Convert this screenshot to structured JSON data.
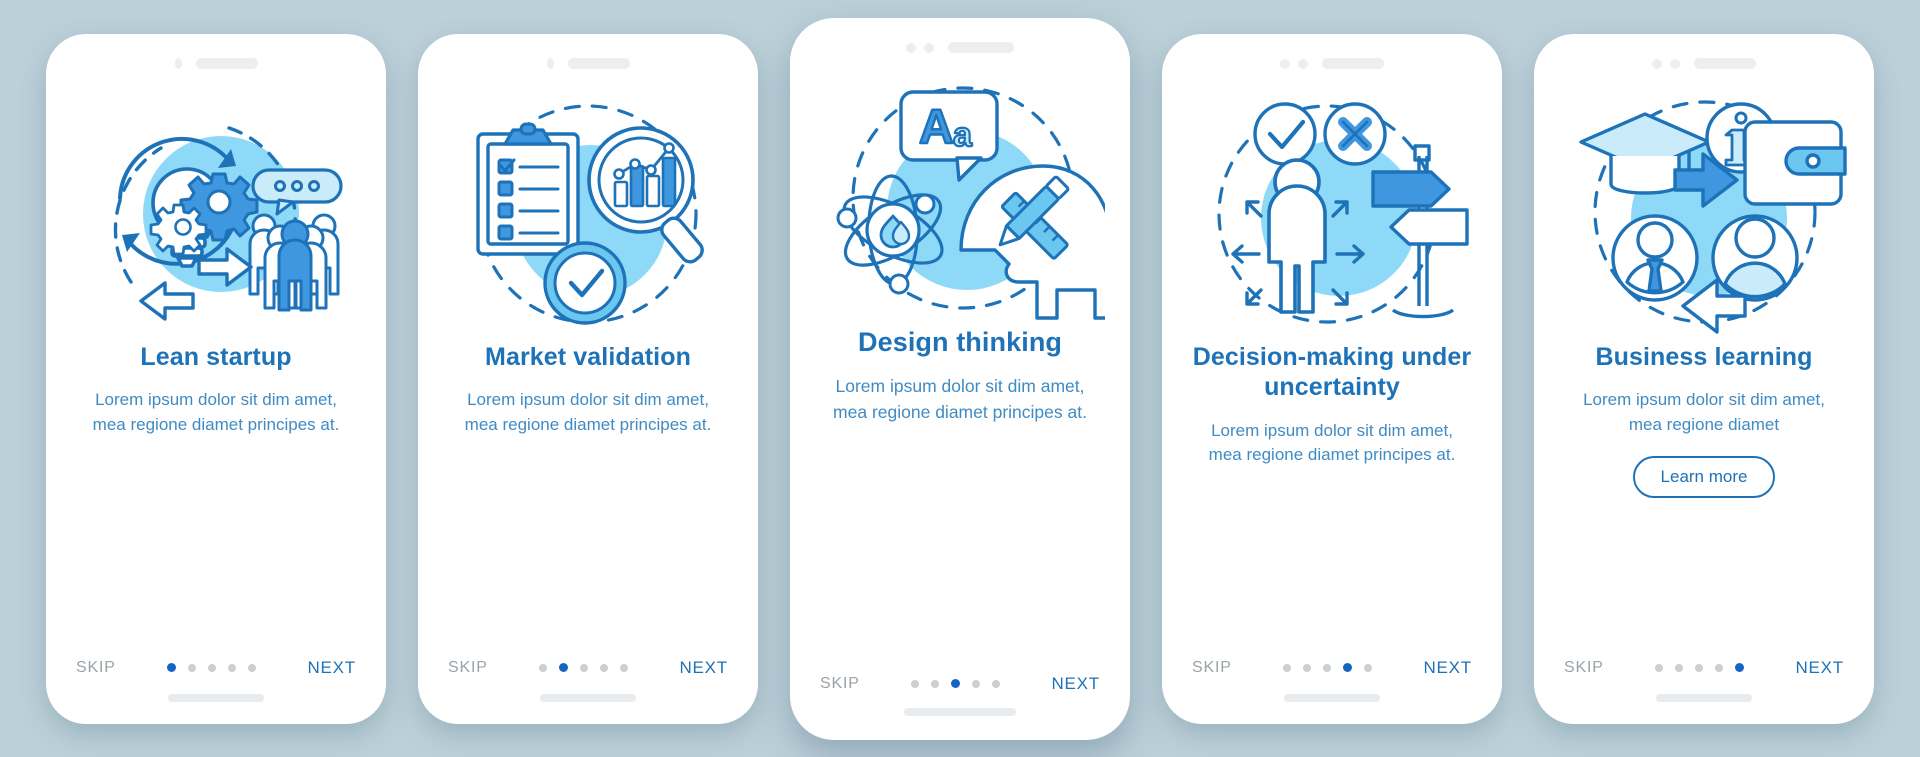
{
  "canvas": {
    "background_color": "#bcd0d9",
    "accent_color": "#1d72b8",
    "accent_dark": "#1565c0",
    "light_blue_fill": "#8ed8f8",
    "pale_blue_fill": "#c9ebfa",
    "muted_text_color": "#9aa3a8",
    "body_text_color": "#3f8bc4"
  },
  "common": {
    "skip_label": "SKIP",
    "next_label": "NEXT",
    "body_text": "Lorem ipsum dolor sit dim amet, mea regione diamet principes at.",
    "body_text_short": "Lorem ipsum dolor sit dim amet, mea regione diamet",
    "dot_count": 5
  },
  "screens": [
    {
      "id": "lean-startup",
      "title": "Lean startup",
      "body": "Lorem ipsum dolor sit dim amet, mea regione diamet principes at.",
      "skip_label": "SKIP",
      "next_label": "NEXT",
      "active_dot": 1,
      "icon_name": "lightbulb-gears-team-icon",
      "featured": false,
      "camera_dots": 1,
      "cta": null
    },
    {
      "id": "market-validation",
      "title": "Market validation",
      "body": "Lorem ipsum dolor sit dim amet, mea regione diamet principes at.",
      "skip_label": "SKIP",
      "next_label": "NEXT",
      "active_dot": 2,
      "icon_name": "clipboard-checklist-magnifier-icon",
      "featured": false,
      "camera_dots": 1,
      "cta": null
    },
    {
      "id": "design-thinking",
      "title": "Design thinking",
      "body": "Lorem ipsum dolor sit dim amet, mea regione diamet principes at.",
      "skip_label": "SKIP",
      "next_label": "NEXT",
      "active_dot": 3,
      "icon_name": "head-atom-ruler-pencil-icon",
      "featured": true,
      "camera_dots": 2,
      "cta": null
    },
    {
      "id": "decision-making-under-uncertainty",
      "title": "Decision-making under uncertainty",
      "body": "Lorem ipsum dolor sit dim amet, mea regione diamet principes at.",
      "skip_label": "SKIP",
      "next_label": "NEXT",
      "active_dot": 4,
      "icon_name": "person-signpost-arrows-icon",
      "featured": false,
      "camera_dots": 2,
      "cta": null
    },
    {
      "id": "business-learning",
      "title": "Business learning",
      "body": "Lorem ipsum dolor sit dim amet, mea regione diamet",
      "skip_label": "SKIP",
      "next_label": "NEXT",
      "active_dot": 5,
      "icon_name": "graduation-wallet-avatars-icon",
      "featured": false,
      "camera_dots": 2,
      "cta": "Learn more"
    }
  ]
}
